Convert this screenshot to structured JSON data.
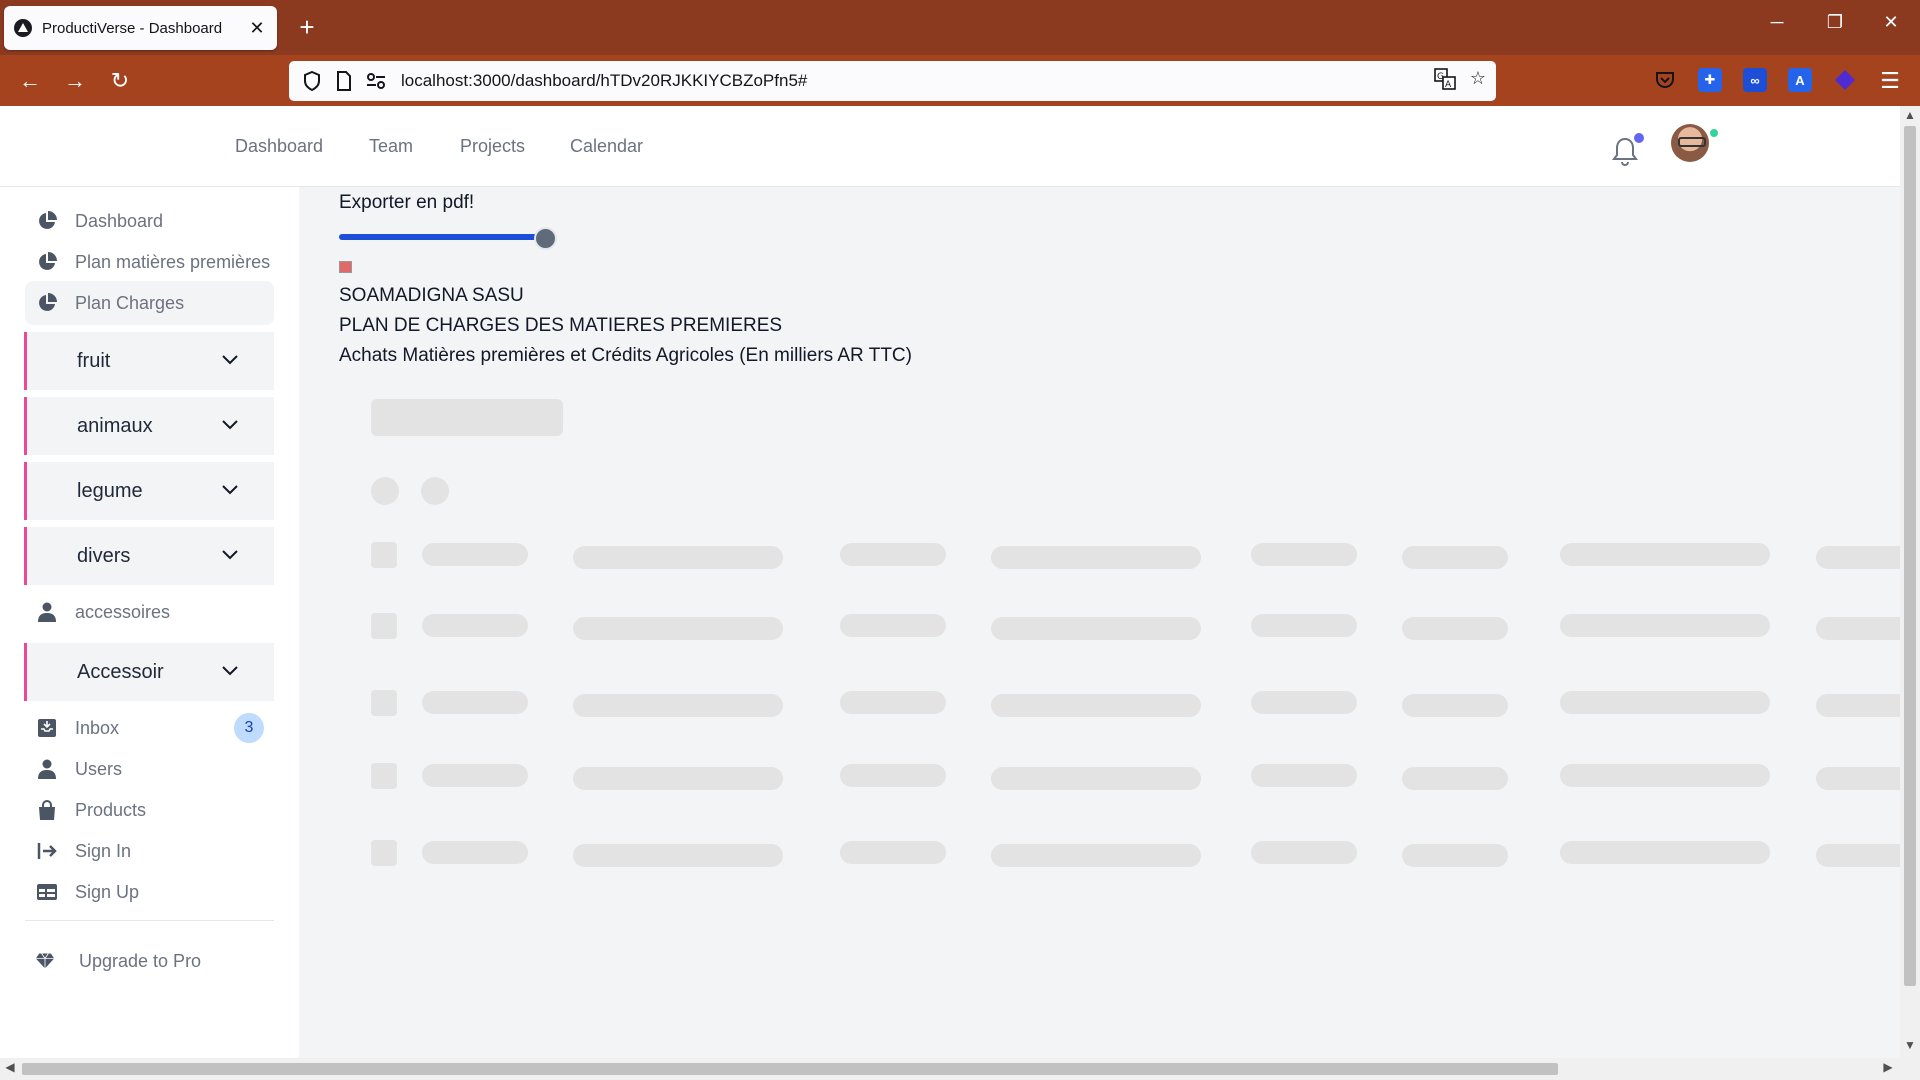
{
  "browser": {
    "tab_title": "ProductiVerse - Dashboard",
    "url": "localhost:3000/dashboard/hTDv20RJKKIYCBZoPfn5#"
  },
  "topnav": {
    "links": [
      "Dashboard",
      "Team",
      "Projects",
      "Calendar"
    ]
  },
  "sidebar": {
    "items": [
      {
        "label": "Dashboard",
        "icon": "pie-chart-icon"
      },
      {
        "label": "Plan matières premières",
        "icon": "pie-chart-icon"
      },
      {
        "label": "Plan Charges",
        "icon": "pie-chart-icon",
        "active": true
      }
    ],
    "dropdowns": [
      "fruit",
      "animaux",
      "legume",
      "divers"
    ],
    "accessoires_label": "accessoires",
    "accessoir_dropdown": "Accessoir",
    "lower_items": [
      {
        "label": "Inbox",
        "icon": "inbox-icon",
        "badge": "3"
      },
      {
        "label": "Users",
        "icon": "user-icon"
      },
      {
        "label": "Products",
        "icon": "shopping-bag-icon"
      },
      {
        "label": "Sign In",
        "icon": "sign-in-icon"
      },
      {
        "label": "Sign Up",
        "icon": "table-icon"
      }
    ],
    "upgrade_label": "Upgrade to Pro"
  },
  "main": {
    "export_label": "Exporter en pdf!",
    "slider_value": 0.9,
    "company": "SOAMADIGNA SASU",
    "plan_title": "PLAN DE CHARGES DES MATIERES PREMIERES",
    "subtitle": "Achats Matières premières et Crédits Agricoles (En milliers AR TTC)"
  },
  "colors": {
    "titlebar": "#8b3a20",
    "navbar": "#a5431f",
    "accent_border": "#ec4899",
    "slider": "#1d4ed8"
  }
}
